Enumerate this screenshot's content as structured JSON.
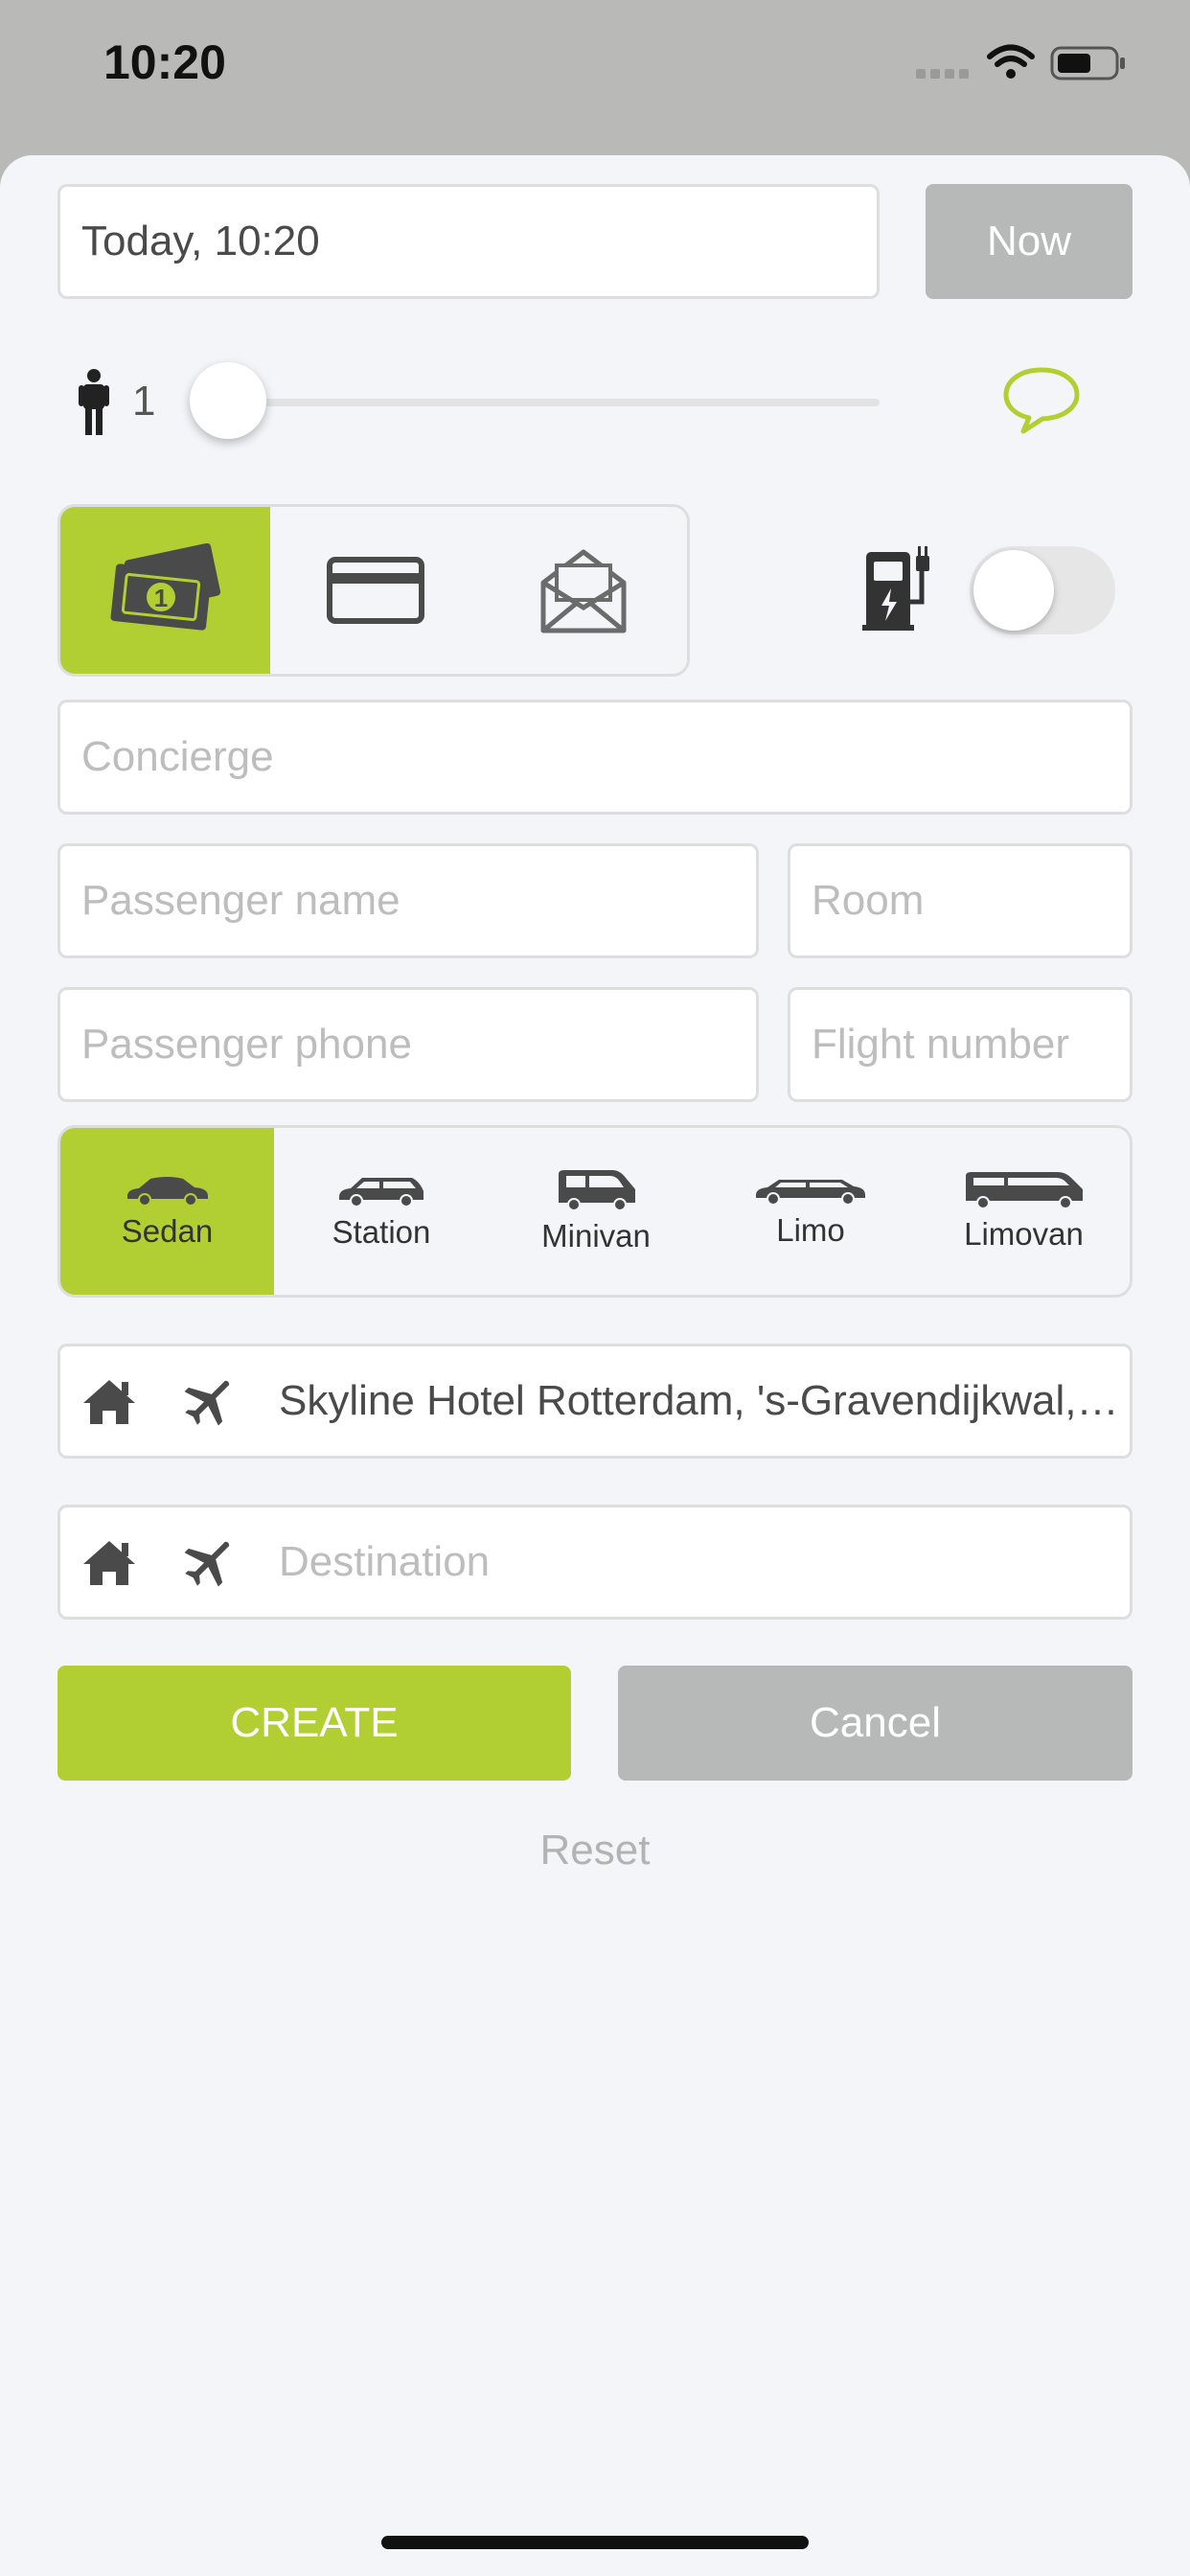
{
  "status_bar": {
    "time": "10:20"
  },
  "datetime": {
    "value": "Today, 10:20",
    "now_label": "Now"
  },
  "passengers": {
    "count": "1"
  },
  "payment": {
    "options": [
      "cash-icon",
      "card-icon",
      "invoice-icon"
    ],
    "selected": 0
  },
  "electric_toggle": {
    "on": false
  },
  "fields": {
    "concierge": "Concierge",
    "passenger_name": "Passenger name",
    "room": "Room",
    "passenger_phone": "Passenger phone",
    "flight_number": "Flight number"
  },
  "vehicles": {
    "items": [
      {
        "label": "Sedan"
      },
      {
        "label": "Station"
      },
      {
        "label": "Minivan"
      },
      {
        "label": "Limo"
      },
      {
        "label": "Limovan"
      }
    ],
    "selected": 0
  },
  "pickup": {
    "value": "Skyline Hotel Rotterdam, 's-Gravendijkwal,…"
  },
  "destination": {
    "placeholder": "Destination"
  },
  "actions": {
    "create": "CREATE",
    "cancel": "Cancel",
    "reset": "Reset"
  },
  "colors": {
    "accent": "#b1cf32",
    "gray_button": "#b7b8b8",
    "background": "#f3f5f9"
  }
}
